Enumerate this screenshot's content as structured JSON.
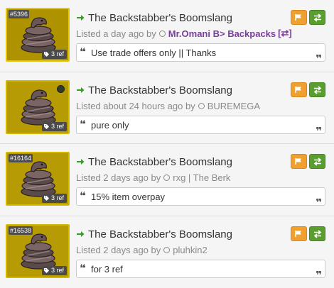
{
  "listings": [
    {
      "craft_number": "#5396",
      "price": "3 ref",
      "title": "The Backstabber's Boomslang",
      "listed_prefix": "Listed a day ago by",
      "user": "Mr.Omani B> Backpacks",
      "user_swap_icon": "[⇄]",
      "comment": "Use trade offers only || Thanks",
      "has_paint": false
    },
    {
      "craft_number": "",
      "price": "3 ref",
      "title": "The Backstabber's Boomslang",
      "listed_prefix": "Listed about 24 hours ago by",
      "user": "BUREMEGA",
      "comment": "pure only",
      "has_paint": true
    },
    {
      "craft_number": "#16164",
      "price": "3 ref",
      "title": "The Backstabber's Boomslang",
      "listed_prefix": "Listed 2 days ago by",
      "user": "rxg | The Berk",
      "comment": "15% item overpay",
      "has_paint": false
    },
    {
      "craft_number": "#16538",
      "price": "3 ref",
      "title": "The Backstabber's Boomslang",
      "listed_prefix": "Listed 2 days ago by",
      "user": "pluhkin2",
      "comment": "for 3 ref",
      "has_paint": false
    }
  ],
  "icons": {
    "title_arrow": "arrow-right-icon",
    "flag_button": "flag-icon",
    "trade_button": "exchange-icon",
    "price_tag": "tag-icon",
    "status": "circle-icon",
    "quote_open": "quote-open-icon",
    "quote_close": "quote-close-icon"
  },
  "colors": {
    "unique_quality": "#b69b05",
    "arrow_green": "#3a9a2a",
    "flag_orange": "#f0a030",
    "trade_green": "#5a9e2f",
    "premium_user": "#7a3da0"
  }
}
